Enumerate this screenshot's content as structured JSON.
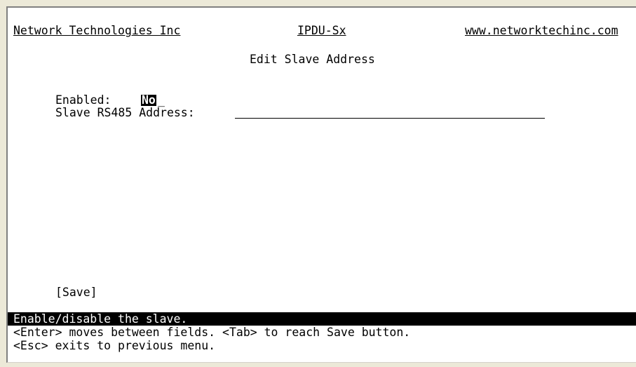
{
  "header": {
    "company": "Network Technologies Inc",
    "product": "IPDU-Sx",
    "url": "www.networktechinc.com"
  },
  "title": "Edit Slave Address",
  "form": {
    "enabled_label": "Enabled:",
    "enabled_value": "No",
    "rs485_label": "Slave RS485 Address:",
    "rs485_value": ""
  },
  "save_button": "[Save]",
  "help": {
    "status": "Enable/disable the slave.",
    "hint1": "<Enter> moves between fields. <Tab> to reach Save button.",
    "hint2": "<Esc> exits to previous menu."
  }
}
